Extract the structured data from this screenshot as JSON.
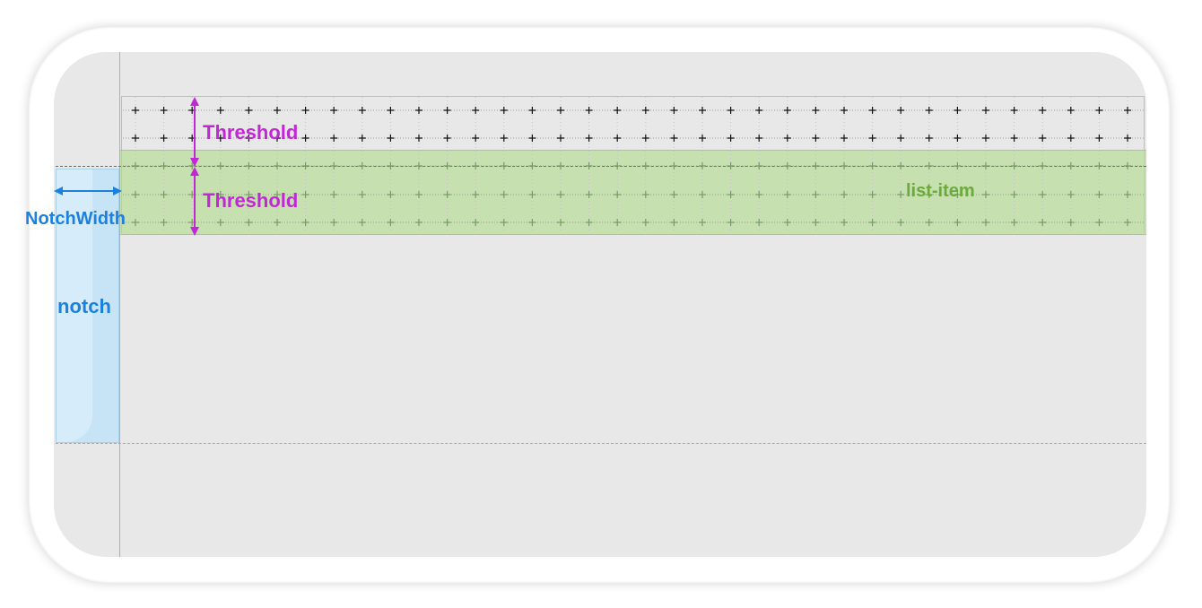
{
  "labels": {
    "threshold_top": "Threshold",
    "threshold_bottom": "Threshold",
    "notch_width": "NotchWidth",
    "notch": "notch",
    "list_item": "list-item"
  },
  "colors": {
    "threshold": "#c028d6",
    "notch": "#1c80e0",
    "list_item": "#6caa3c",
    "red_dashed_line": "#b84848"
  }
}
